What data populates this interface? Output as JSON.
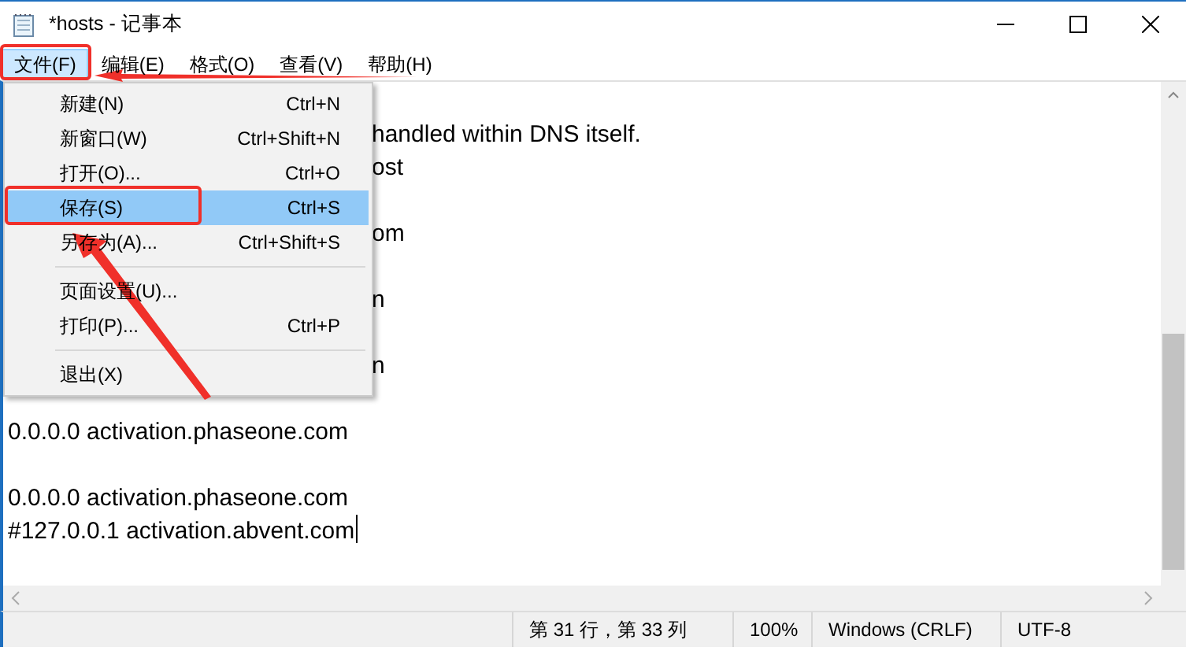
{
  "window": {
    "title": "*hosts - 记事本"
  },
  "menu_bar": [
    {
      "label": "文件(F)",
      "selected": true
    },
    {
      "label": "编辑(E)",
      "selected": false
    },
    {
      "label": "格式(O)",
      "selected": false
    },
    {
      "label": "查看(V)",
      "selected": false
    },
    {
      "label": "帮助(H)",
      "selected": false
    }
  ],
  "file_menu": [
    {
      "kind": "item",
      "label": "新建(N)",
      "shortcut": "Ctrl+N",
      "selected": false
    },
    {
      "kind": "item",
      "label": "新窗口(W)",
      "shortcut": "Ctrl+Shift+N",
      "selected": false
    },
    {
      "kind": "item",
      "label": "打开(O)...",
      "shortcut": "Ctrl+O",
      "selected": false
    },
    {
      "kind": "item",
      "label": "保存(S)",
      "shortcut": "Ctrl+S",
      "selected": true
    },
    {
      "kind": "item",
      "label": "另存为(A)...",
      "shortcut": "Ctrl+Shift+S",
      "selected": false
    },
    {
      "kind": "separator"
    },
    {
      "kind": "item",
      "label": "页面设置(U)...",
      "selected": false
    },
    {
      "kind": "item",
      "label": "打印(P)...",
      "shortcut": "Ctrl+P",
      "selected": false
    },
    {
      "kind": "separator"
    },
    {
      "kind": "item",
      "label": "退出(X)",
      "selected": false
    }
  ],
  "editor_lines": [
    {
      "kind": "blank"
    },
    {
      "kind": "partial",
      "text": "handled within DNS itself."
    },
    {
      "kind": "partial",
      "text": "ost"
    },
    {
      "kind": "blank"
    },
    {
      "kind": "partial",
      "text": "om"
    },
    {
      "kind": "blank"
    },
    {
      "kind": "partial",
      "text": "n"
    },
    {
      "kind": "blank"
    },
    {
      "kind": "partial",
      "text": "n"
    },
    {
      "kind": "blank"
    },
    {
      "kind": "full",
      "text": "0.0.0.0 activation.phaseone.com"
    },
    {
      "kind": "blank"
    },
    {
      "kind": "full",
      "text": "0.0.0.0 activation.phaseone.com"
    },
    {
      "kind": "full",
      "text": "#127.0.0.1 activation.abvent.com",
      "caret": true
    }
  ],
  "status_bar": {
    "position": "第 31 行，第 33 列",
    "zoom": "100%",
    "line_ending": "Windows (CRLF)",
    "encoding": "UTF-8"
  }
}
